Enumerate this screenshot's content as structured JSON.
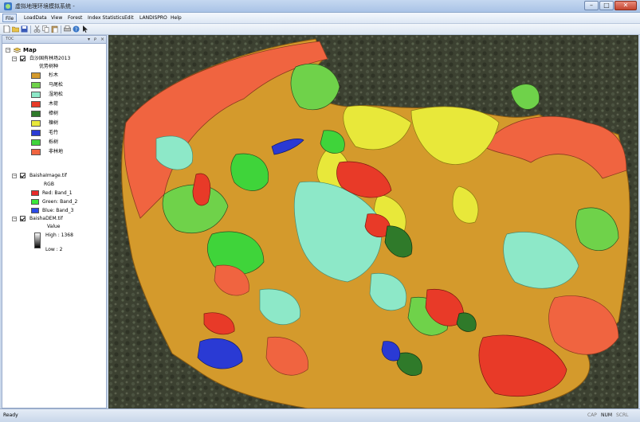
{
  "window": {
    "title": "虚拟地理环境模拟系统 -"
  },
  "menu": [
    "File",
    "LoadData",
    "View",
    "Forest",
    "Index Statistics",
    "Edit",
    "LANDISPRO",
    "Help"
  ],
  "toc": {
    "header": "TOC",
    "root": "Map",
    "forest_layer": {
      "name": "白沙国有林场2013",
      "group_label": "优势树种",
      "classes": [
        {
          "label": "杉木",
          "color": "#d49a2c"
        },
        {
          "label": "马尾松",
          "color": "#6fd24a"
        },
        {
          "label": "湿地松",
          "color": "#8de8c8"
        },
        {
          "label": "木荷",
          "color": "#e83a28"
        },
        {
          "label": "樟树",
          "color": "#2f7a2a"
        },
        {
          "label": "楝树",
          "color": "#e8e83a"
        },
        {
          "label": "毛竹",
          "color": "#2a3ad4"
        },
        {
          "label": "栎树",
          "color": "#3fd43a"
        },
        {
          "label": "非林地",
          "color": "#f06440"
        }
      ]
    },
    "image_layer": {
      "name": "BaishaImage.tif",
      "group_label": "RGB",
      "bands": [
        {
          "label": "Red:   Band_1",
          "color": "#e82a2a"
        },
        {
          "label": "Green: Band_2",
          "color": "#3ae83a"
        },
        {
          "label": "Blue:   Band_3",
          "color": "#2a4ae8"
        }
      ]
    },
    "dem_layer": {
      "name": "BaishaDEM.tif",
      "value_label": "Value",
      "high_label": "High : 1368",
      "low_label": "Low : 2"
    }
  },
  "status": {
    "text": "Ready",
    "indicators": [
      {
        "label": "CAP",
        "on": false
      },
      {
        "label": "NUM",
        "on": true
      },
      {
        "label": "SCRL",
        "on": false
      }
    ]
  },
  "colors": {
    "cunninghamia": "#d49a2c",
    "masson_pine": "#6fd24a",
    "slash_pine": "#8de8c8",
    "schima": "#e83a28",
    "camphor": "#2f7a2a",
    "chinaberry": "#e8e83a",
    "bamboo": "#2a3ad4",
    "oak": "#3fd43a",
    "non_forest": "#f06440"
  }
}
